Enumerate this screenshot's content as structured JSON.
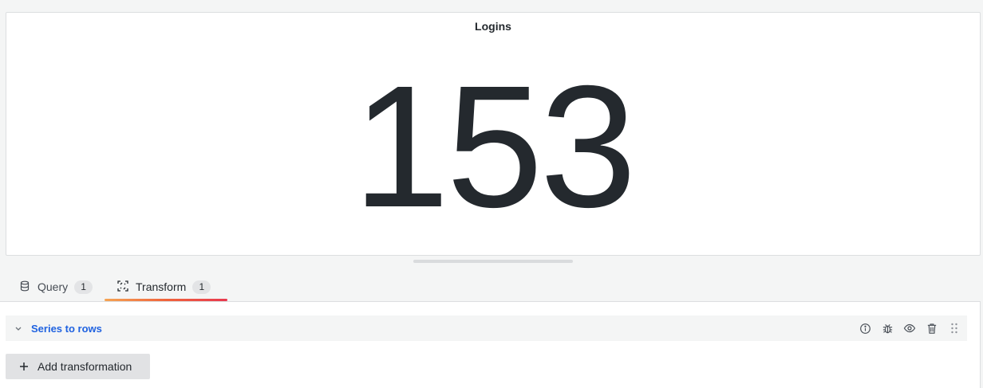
{
  "panel": {
    "title": "Logins",
    "value": "153"
  },
  "tabs": [
    {
      "label": "Query",
      "count": "1",
      "icon": "database-icon"
    },
    {
      "label": "Transform",
      "count": "1",
      "icon": "transform-icon",
      "active": true
    }
  ],
  "transformations": [
    {
      "title": "Series to rows"
    }
  ],
  "add_button": {
    "label": "Add transformation"
  },
  "colors": {
    "link": "#1f62e0",
    "text": "#24292e",
    "accent_start": "#f5a454",
    "accent_end": "#e8394f"
  }
}
